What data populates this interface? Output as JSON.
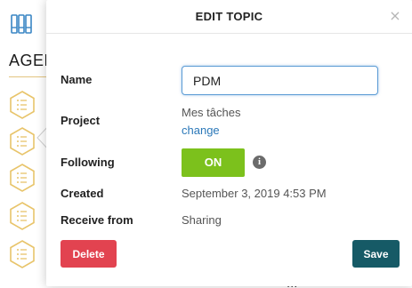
{
  "background": {
    "agenda_title": "AGENDA",
    "partial_text": "...",
    "books_icon": "books-icon",
    "item_icon": "hexagon-list-icon",
    "accent_color": "#e8c46a"
  },
  "modal": {
    "title": "EDIT TOPIC",
    "close_symbol": "×",
    "fields": {
      "name_label": "Name",
      "name_value": "PDM",
      "project_label": "Project",
      "project_value": "Mes tâches",
      "project_change_link": "change",
      "following_label": "Following",
      "following_toggle": "ON",
      "created_label": "Created",
      "created_value": "September 3, 2019 4:53 PM",
      "receive_from_label": "Receive from",
      "receive_from_value": "Sharing"
    },
    "actions": {
      "delete_label": "Delete",
      "save_label": "Save"
    },
    "colors": {
      "toggle_on": "#7cc11c",
      "delete": "#e24350",
      "save": "#165a66",
      "link": "#2b78b8"
    }
  }
}
